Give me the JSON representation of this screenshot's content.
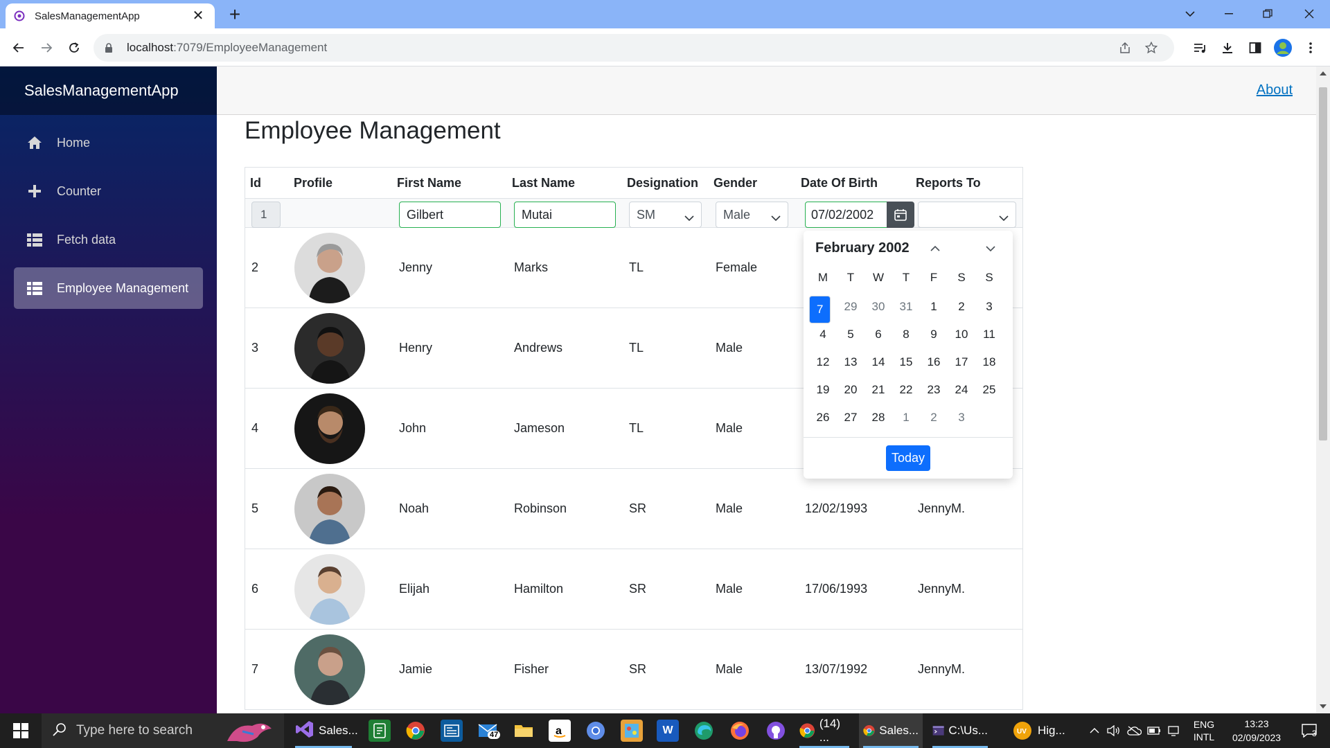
{
  "browser": {
    "tab_title": "SalesManagementApp",
    "tab_close": "✕",
    "new_tab": "+",
    "url_host": "localhost",
    "url_rest": ":7079/EmployeeManagement"
  },
  "app": {
    "brand": "SalesManagementApp",
    "about_link": "About",
    "nav": [
      {
        "label": "Home",
        "icon": "home-icon"
      },
      {
        "label": "Counter",
        "icon": "plus-icon"
      },
      {
        "label": "Fetch data",
        "icon": "list-icon"
      },
      {
        "label": "Employee Management",
        "icon": "list-icon"
      }
    ],
    "page_title": "Employee Management"
  },
  "grid": {
    "columns": [
      "Id",
      "Profile",
      "First Name",
      "Last Name",
      "Designation",
      "Gender",
      "Date Of Birth",
      "Reports To"
    ],
    "edit_row": {
      "id": "1",
      "first_name": "Gilbert",
      "last_name": "Mutai",
      "designation": "SM",
      "gender": "Male",
      "date_of_birth": "07/02/2002",
      "reports_to": ""
    },
    "rows": [
      {
        "id": "2",
        "first_name": "Jenny",
        "last_name": "Marks",
        "designation": "TL",
        "gender": "Female",
        "dob": "",
        "reports_to": ""
      },
      {
        "id": "3",
        "first_name": "Henry",
        "last_name": "Andrews",
        "designation": "TL",
        "gender": "Male",
        "dob": "",
        "reports_to": ""
      },
      {
        "id": "4",
        "first_name": "John",
        "last_name": "Jameson",
        "designation": "TL",
        "gender": "Male",
        "dob": "",
        "reports_to": ""
      },
      {
        "id": "5",
        "first_name": "Noah",
        "last_name": "Robinson",
        "designation": "SR",
        "gender": "Male",
        "dob": "12/02/1993",
        "reports_to": "JennyM."
      },
      {
        "id": "6",
        "first_name": "Elijah",
        "last_name": "Hamilton",
        "designation": "SR",
        "gender": "Male",
        "dob": "17/06/1993",
        "reports_to": "JennyM."
      },
      {
        "id": "7",
        "first_name": "Jamie",
        "last_name": "Fisher",
        "designation": "SR",
        "gender": "Male",
        "dob": "13/07/1992",
        "reports_to": "JennyM."
      }
    ]
  },
  "calendar": {
    "title": "February 2002",
    "weekdays": [
      "M",
      "T",
      "W",
      "T",
      "F",
      "S",
      "S"
    ],
    "days": [
      {
        "d": "28",
        "m": true
      },
      {
        "d": "29",
        "m": true
      },
      {
        "d": "30",
        "m": true
      },
      {
        "d": "31",
        "m": true
      },
      {
        "d": "1"
      },
      {
        "d": "2"
      },
      {
        "d": "3"
      },
      {
        "d": "4"
      },
      {
        "d": "5"
      },
      {
        "d": "6"
      },
      {
        "d": "7",
        "s": true
      },
      {
        "d": "8"
      },
      {
        "d": "9"
      },
      {
        "d": "10"
      },
      {
        "d": "11"
      },
      {
        "d": "12"
      },
      {
        "d": "13"
      },
      {
        "d": "14"
      },
      {
        "d": "15"
      },
      {
        "d": "16"
      },
      {
        "d": "17"
      },
      {
        "d": "18"
      },
      {
        "d": "19"
      },
      {
        "d": "20"
      },
      {
        "d": "21"
      },
      {
        "d": "22"
      },
      {
        "d": "23"
      },
      {
        "d": "24"
      },
      {
        "d": "25"
      },
      {
        "d": "26"
      },
      {
        "d": "27"
      },
      {
        "d": "28"
      },
      {
        "d": "1",
        "m": true
      },
      {
        "d": "2",
        "m": true
      },
      {
        "d": "3",
        "m": true
      }
    ],
    "today_button": "Today"
  },
  "taskbar": {
    "search_placeholder": "Type here to search",
    "apps": [
      {
        "label": "Sales..."
      },
      {
        "label": "(14) ..."
      },
      {
        "label": "Sales..."
      },
      {
        "label": "C:\\Us..."
      },
      {
        "label": "Hig..."
      }
    ],
    "mail_badge": "47",
    "lang_top": "ENG",
    "lang_bottom": "INTL",
    "time": "13:23",
    "date": "02/09/2023",
    "notif_count": "3"
  },
  "colors": {
    "sidebar_top": "#052767",
    "sidebar_bottom": "#3a0647",
    "accent": "#0d6efd",
    "valid_border": "#26b050"
  }
}
